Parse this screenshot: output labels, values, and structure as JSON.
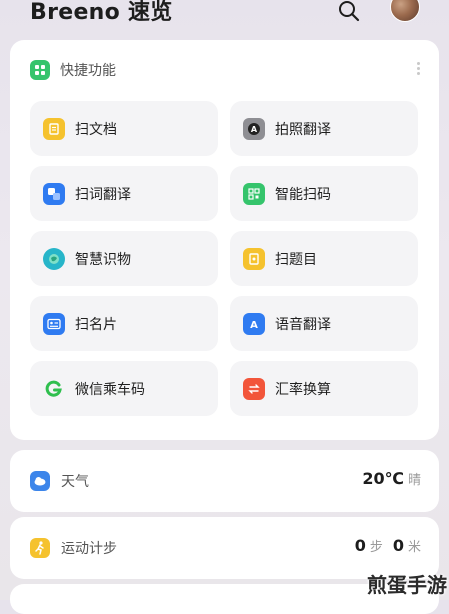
{
  "header": {
    "title": "Breeno 速览"
  },
  "shortcuts": {
    "title": "快捷功能",
    "items": [
      {
        "label": "扫文档",
        "icon": "document-scan-icon",
        "color": "#f5c22e"
      },
      {
        "label": "拍照翻译",
        "icon": "camera-translate-icon",
        "color": "#8e8e93"
      },
      {
        "label": "扫词翻译",
        "icon": "word-translate-icon",
        "color": "#2f7bf1"
      },
      {
        "label": "智能扫码",
        "icon": "qr-scan-icon",
        "color": "#35c46c"
      },
      {
        "label": "智慧识物",
        "icon": "object-recognition-icon",
        "color": "#27b5c9"
      },
      {
        "label": "扫题目",
        "icon": "question-scan-icon",
        "color": "#f5c22e"
      },
      {
        "label": "扫名片",
        "icon": "card-scan-icon",
        "color": "#2f7bf1"
      },
      {
        "label": "语音翻译",
        "icon": "voice-translate-icon",
        "color": "#2f7bf1"
      },
      {
        "label": "微信乘车码",
        "icon": "wechat-bus-code-icon",
        "color": "#2fbf4e"
      },
      {
        "label": "汇率换算",
        "icon": "currency-exchange-icon",
        "color": "#f2553a"
      }
    ]
  },
  "weather": {
    "label": "天气",
    "temp": "20℃",
    "condition": "晴",
    "icon": "weather-icon",
    "color": "#3c85ea"
  },
  "steps": {
    "label": "运动计步",
    "steps_value": "0",
    "steps_unit": "步",
    "distance_value": "0",
    "distance_unit": "米",
    "icon": "running-icon",
    "color": "#f5c22e"
  },
  "watermark": "煎蛋手游"
}
